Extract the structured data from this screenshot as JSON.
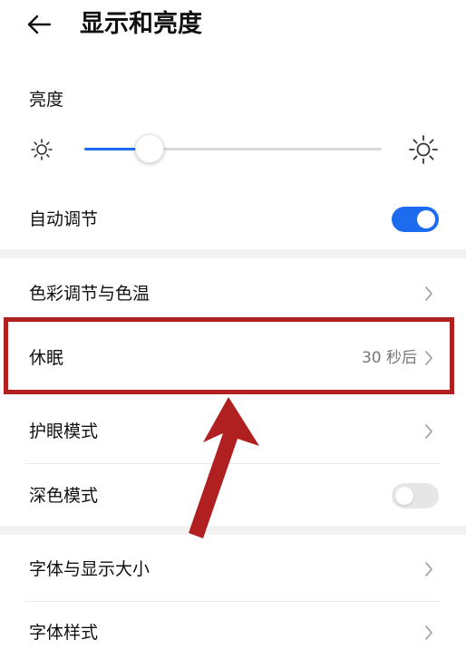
{
  "header": {
    "title": "显示和亮度",
    "back_icon": "back-arrow-icon"
  },
  "brightness": {
    "label": "亮度",
    "level_percent": 22,
    "min_icon": "sun-small-icon",
    "max_icon": "sun-large-icon"
  },
  "auto_adjust": {
    "label": "自动调节",
    "enabled": true
  },
  "menu": {
    "color_temp": {
      "label": "色彩调节与色温"
    },
    "sleep": {
      "label": "休眠",
      "value": "30 秒后"
    },
    "eye_comfort": {
      "label": "护眼模式"
    },
    "dark_mode": {
      "label": "深色模式",
      "enabled": false
    },
    "font_size": {
      "label": "字体与显示大小"
    },
    "font_style": {
      "label": "字体样式"
    }
  },
  "colors": {
    "accent": "#1d6cf0",
    "annotation": "#b02020"
  }
}
